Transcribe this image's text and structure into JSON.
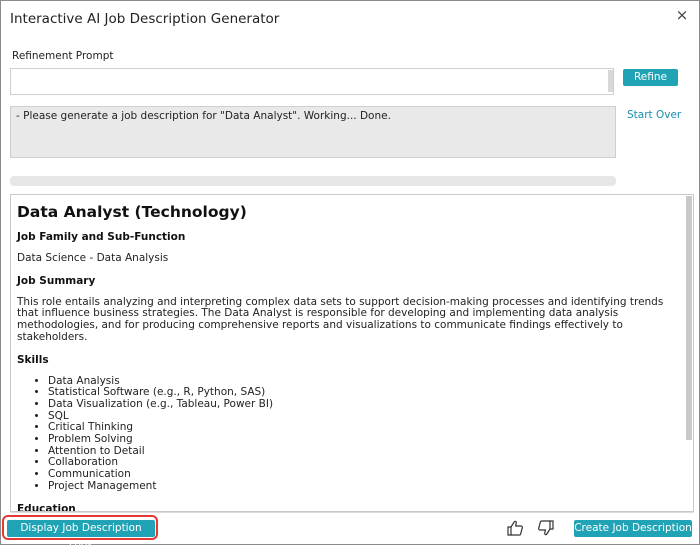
{
  "dialog": {
    "title": "Interactive AI Job Description Generator",
    "close_glyph": "×"
  },
  "refinement": {
    "label": "Refinement Prompt",
    "input_value": "",
    "refine_label": "Refine"
  },
  "status": {
    "text": "- Please generate a job description for \"Data Analyst\". Working... Done.",
    "start_over_label": "Start Over"
  },
  "document": {
    "title": "Data Analyst (Technology)",
    "job_family_heading": "Job Family and Sub-Function",
    "job_family_value": "Data Science - Data Analysis",
    "summary_heading": "Job Summary",
    "summary_text": "This role entails analyzing and interpreting complex data sets to support decision-making processes and identifying trends that influence business strategies. The Data Analyst is responsible for developing and implementing data analysis methodologies, and for producing comprehensive reports and visualizations to communicate findings effectively to stakeholders.",
    "skills_heading": "Skills",
    "skills": [
      "Data Analysis",
      "Statistical Software (e.g., R, Python, SAS)",
      "Data Visualization (e.g., Tableau, Power BI)",
      "SQL",
      "Critical Thinking",
      "Problem Solving",
      "Attention to Detail",
      "Collaboration",
      "Communication",
      "Project Management"
    ],
    "education_heading": "Education"
  },
  "footer": {
    "logs_label": "Display Job Description Logs",
    "create_label": "Create Job Description"
  },
  "icons": {
    "close": "close-icon",
    "thumbs_up": "thumbs-up-icon",
    "thumbs_down": "thumbs-down-icon"
  },
  "colors": {
    "accent": "#1fa3b5",
    "link": "#1a8fb0",
    "highlight_ring": "#e53935"
  }
}
